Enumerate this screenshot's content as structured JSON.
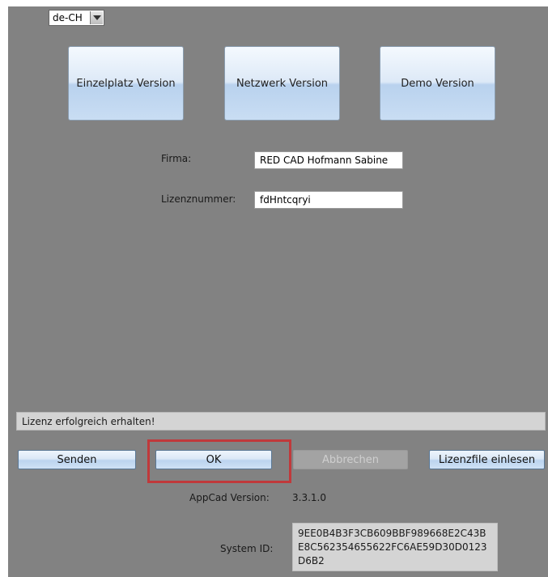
{
  "language": {
    "selected": "de-CH"
  },
  "version_buttons": {
    "einzelplatz": "Einzelplatz Version",
    "netzwerk": "Netzwerk Version",
    "demo": "Demo Version"
  },
  "form": {
    "firma_label": "Firma:",
    "firma_value": "RED CAD Hofmann Sabine",
    "lizenz_label": "Lizenznummer:",
    "lizenz_value": "fdHntcqryi"
  },
  "status_text": "Lizenz erfolgreich erhalten!",
  "actions": {
    "senden": "Senden",
    "ok": "OK",
    "abbrechen": "Abbrechen",
    "lizenzfile": "Lizenzfile einlesen"
  },
  "info": {
    "appcad_label": "AppCad Version:",
    "appcad_value": "3.3.1.0",
    "system_id_label": "System ID:",
    "system_id_value": "9EE0B4B3F3CB609BBF989668E2C43BE8C562354655622FC6AE59D30D0123D6B2"
  },
  "colors": {
    "background": "#828282",
    "button_blue": "#c9ddf3",
    "highlight_frame": "#c0393b"
  }
}
